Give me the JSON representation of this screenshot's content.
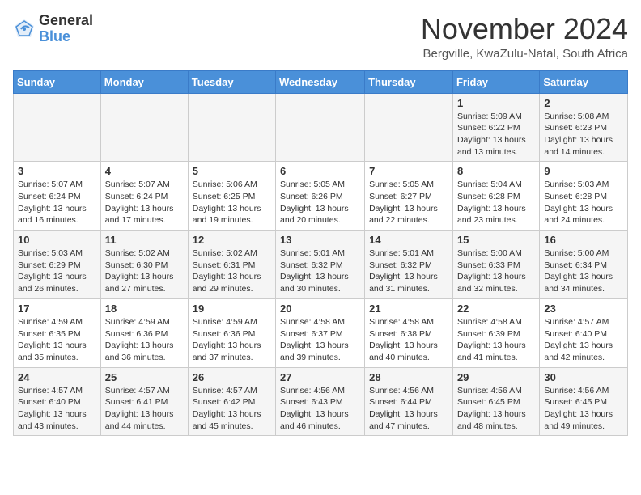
{
  "logo": {
    "general": "General",
    "blue": "Blue"
  },
  "title": "November 2024",
  "subtitle": "Bergville, KwaZulu-Natal, South Africa",
  "days_header": [
    "Sunday",
    "Monday",
    "Tuesday",
    "Wednesday",
    "Thursday",
    "Friday",
    "Saturday"
  ],
  "weeks": [
    [
      {
        "day": "",
        "info": ""
      },
      {
        "day": "",
        "info": ""
      },
      {
        "day": "",
        "info": ""
      },
      {
        "day": "",
        "info": ""
      },
      {
        "day": "",
        "info": ""
      },
      {
        "day": "1",
        "info": "Sunrise: 5:09 AM\nSunset: 6:22 PM\nDaylight: 13 hours and 13 minutes."
      },
      {
        "day": "2",
        "info": "Sunrise: 5:08 AM\nSunset: 6:23 PM\nDaylight: 13 hours and 14 minutes."
      }
    ],
    [
      {
        "day": "3",
        "info": "Sunrise: 5:07 AM\nSunset: 6:24 PM\nDaylight: 13 hours and 16 minutes."
      },
      {
        "day": "4",
        "info": "Sunrise: 5:07 AM\nSunset: 6:24 PM\nDaylight: 13 hours and 17 minutes."
      },
      {
        "day": "5",
        "info": "Sunrise: 5:06 AM\nSunset: 6:25 PM\nDaylight: 13 hours and 19 minutes."
      },
      {
        "day": "6",
        "info": "Sunrise: 5:05 AM\nSunset: 6:26 PM\nDaylight: 13 hours and 20 minutes."
      },
      {
        "day": "7",
        "info": "Sunrise: 5:05 AM\nSunset: 6:27 PM\nDaylight: 13 hours and 22 minutes."
      },
      {
        "day": "8",
        "info": "Sunrise: 5:04 AM\nSunset: 6:28 PM\nDaylight: 13 hours and 23 minutes."
      },
      {
        "day": "9",
        "info": "Sunrise: 5:03 AM\nSunset: 6:28 PM\nDaylight: 13 hours and 24 minutes."
      }
    ],
    [
      {
        "day": "10",
        "info": "Sunrise: 5:03 AM\nSunset: 6:29 PM\nDaylight: 13 hours and 26 minutes."
      },
      {
        "day": "11",
        "info": "Sunrise: 5:02 AM\nSunset: 6:30 PM\nDaylight: 13 hours and 27 minutes."
      },
      {
        "day": "12",
        "info": "Sunrise: 5:02 AM\nSunset: 6:31 PM\nDaylight: 13 hours and 29 minutes."
      },
      {
        "day": "13",
        "info": "Sunrise: 5:01 AM\nSunset: 6:32 PM\nDaylight: 13 hours and 30 minutes."
      },
      {
        "day": "14",
        "info": "Sunrise: 5:01 AM\nSunset: 6:32 PM\nDaylight: 13 hours and 31 minutes."
      },
      {
        "day": "15",
        "info": "Sunrise: 5:00 AM\nSunset: 6:33 PM\nDaylight: 13 hours and 32 minutes."
      },
      {
        "day": "16",
        "info": "Sunrise: 5:00 AM\nSunset: 6:34 PM\nDaylight: 13 hours and 34 minutes."
      }
    ],
    [
      {
        "day": "17",
        "info": "Sunrise: 4:59 AM\nSunset: 6:35 PM\nDaylight: 13 hours and 35 minutes."
      },
      {
        "day": "18",
        "info": "Sunrise: 4:59 AM\nSunset: 6:36 PM\nDaylight: 13 hours and 36 minutes."
      },
      {
        "day": "19",
        "info": "Sunrise: 4:59 AM\nSunset: 6:36 PM\nDaylight: 13 hours and 37 minutes."
      },
      {
        "day": "20",
        "info": "Sunrise: 4:58 AM\nSunset: 6:37 PM\nDaylight: 13 hours and 39 minutes."
      },
      {
        "day": "21",
        "info": "Sunrise: 4:58 AM\nSunset: 6:38 PM\nDaylight: 13 hours and 40 minutes."
      },
      {
        "day": "22",
        "info": "Sunrise: 4:58 AM\nSunset: 6:39 PM\nDaylight: 13 hours and 41 minutes."
      },
      {
        "day": "23",
        "info": "Sunrise: 4:57 AM\nSunset: 6:40 PM\nDaylight: 13 hours and 42 minutes."
      }
    ],
    [
      {
        "day": "24",
        "info": "Sunrise: 4:57 AM\nSunset: 6:40 PM\nDaylight: 13 hours and 43 minutes."
      },
      {
        "day": "25",
        "info": "Sunrise: 4:57 AM\nSunset: 6:41 PM\nDaylight: 13 hours and 44 minutes."
      },
      {
        "day": "26",
        "info": "Sunrise: 4:57 AM\nSunset: 6:42 PM\nDaylight: 13 hours and 45 minutes."
      },
      {
        "day": "27",
        "info": "Sunrise: 4:56 AM\nSunset: 6:43 PM\nDaylight: 13 hours and 46 minutes."
      },
      {
        "day": "28",
        "info": "Sunrise: 4:56 AM\nSunset: 6:44 PM\nDaylight: 13 hours and 47 minutes."
      },
      {
        "day": "29",
        "info": "Sunrise: 4:56 AM\nSunset: 6:45 PM\nDaylight: 13 hours and 48 minutes."
      },
      {
        "day": "30",
        "info": "Sunrise: 4:56 AM\nSunset: 6:45 PM\nDaylight: 13 hours and 49 minutes."
      }
    ]
  ]
}
